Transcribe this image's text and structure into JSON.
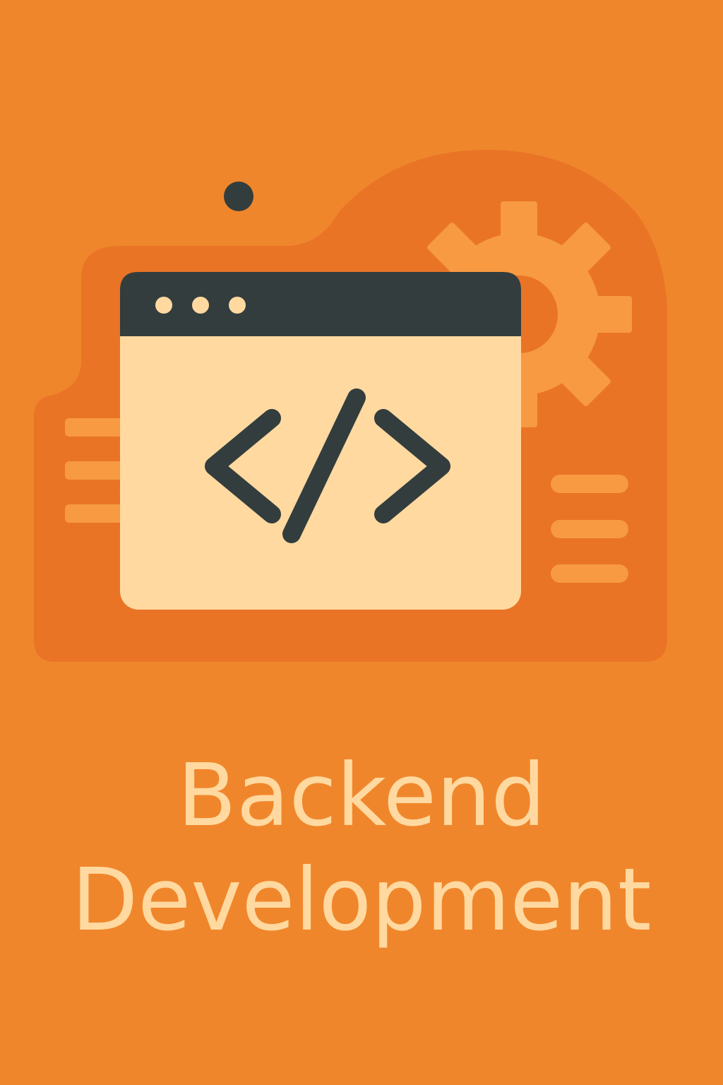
{
  "title": {
    "line1": "Backend",
    "line2": "Development"
  },
  "illustration": {
    "icons": [
      "browser-window-icon",
      "code-brackets-icon",
      "gear-icon",
      "dot-icon"
    ]
  },
  "colors": {
    "background": "#F0862B",
    "blob": "#E97426",
    "accent_light": "#F79A42",
    "window_body": "#FFD9A0",
    "window_bar": "#333D3D",
    "title_text": "#FFD9A0"
  }
}
